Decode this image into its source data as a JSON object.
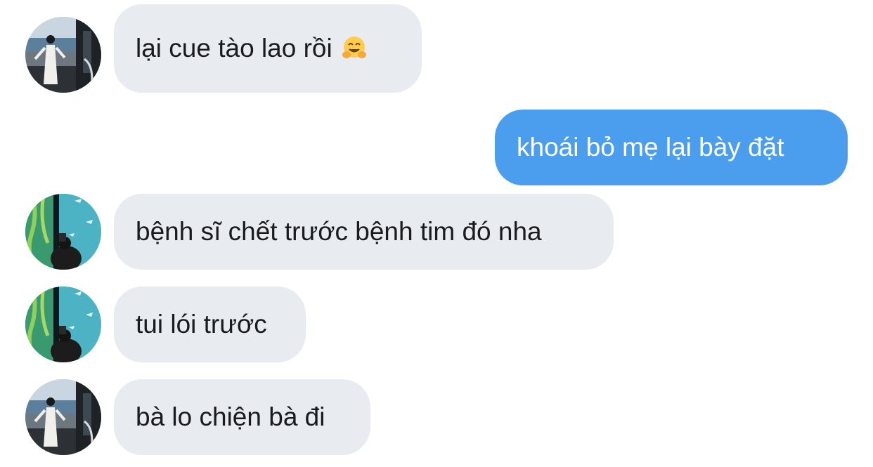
{
  "conversation": {
    "messages": [
      {
        "direction": "incoming",
        "avatar": "avatar-city-girl",
        "text": "lại cue tào lao rồi",
        "emoji": "hugging-face-emoji"
      },
      {
        "direction": "outgoing",
        "text": "khoái bỏ mẹ lại bày đặt"
      },
      {
        "direction": "incoming",
        "avatar": "avatar-aquarium",
        "text": "bệnh sĩ chết trước bệnh tim đó nha"
      },
      {
        "direction": "incoming",
        "avatar": "avatar-aquarium",
        "text": "tui lói trước"
      },
      {
        "direction": "incoming",
        "avatar": "avatar-city-girl",
        "text": "bà lo chiện bà đi"
      }
    ]
  },
  "colors": {
    "incoming_bubble": "#e8ebf0",
    "incoming_text": "#1b1b1d",
    "outgoing_bubble": "#4b9ded",
    "outgoing_text": "#ffffff",
    "background": "#ffffff"
  }
}
